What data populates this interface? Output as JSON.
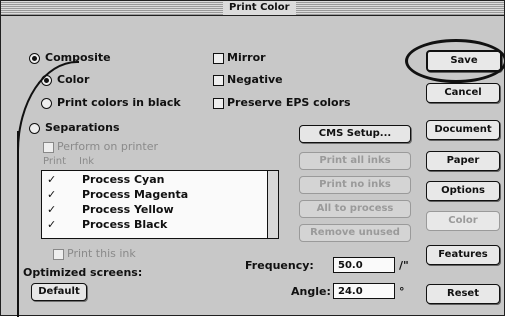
{
  "window": {
    "title": "Print Color"
  },
  "print_options": {
    "composite": "Composite",
    "color": "Color",
    "print_colors_in_black": "Print colors in black",
    "separations": "Separations",
    "perform_on_printer": "Perform on printer",
    "list_header_print": "Print",
    "list_header_ink": "Ink",
    "print_this_ink": "Print this ink",
    "optimized_screens": "Optimized screens:"
  },
  "checkboxes": {
    "mirror": "Mirror",
    "negative": "Negative",
    "preserve_eps_colors": "Preserve EPS colors"
  },
  "inks": [
    {
      "mark": "✓",
      "name": "Process Cyan"
    },
    {
      "mark": "✓",
      "name": "Process Magenta"
    },
    {
      "mark": "✓",
      "name": "Process Yellow"
    },
    {
      "mark": "✓",
      "name": "Process Black"
    }
  ],
  "mid_buttons": {
    "cms_setup": "CMS Setup...",
    "print_all_inks": "Print all inks",
    "print_no_inks": "Print no inks",
    "all_to_process": "All to process",
    "remove_unused": "Remove unused"
  },
  "screens": {
    "default_button": "Default",
    "frequency_label": "Frequency:",
    "frequency_value": "50.0",
    "frequency_unit": "/\"",
    "angle_label": "Angle:",
    "angle_value": "24.0",
    "angle_unit": "°"
  },
  "side_buttons": {
    "save": "Save",
    "cancel": "Cancel",
    "document": "Document",
    "paper": "Paper",
    "options": "Options",
    "color": "Color",
    "features": "Features",
    "reset": "Reset"
  }
}
